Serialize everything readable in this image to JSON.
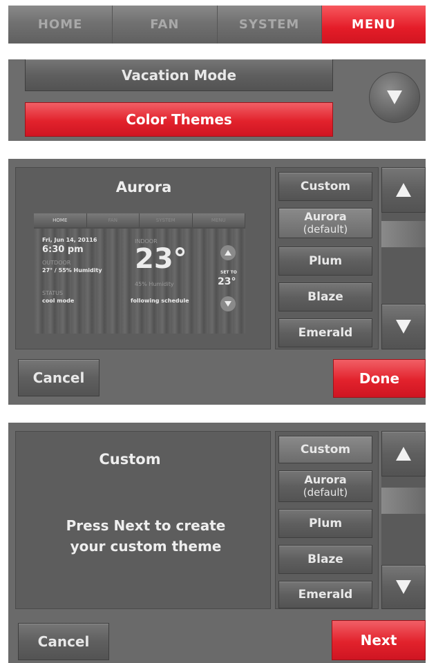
{
  "tabs": [
    "HOME",
    "FAN",
    "SYSTEM",
    "MENU"
  ],
  "menu_list": {
    "vacation_mode": "Vacation Mode",
    "color_themes": "Color Themes"
  },
  "theme_screen_1": {
    "title": "Aurora",
    "preview": {
      "tabs": [
        "HOME",
        "FAN",
        "SYSTEM",
        "MENU"
      ],
      "date": "Fri, Jun 14, 20116",
      "time": "6:30 pm",
      "outdoor_label": "OUTDOOR",
      "outdoor_value": "27° / 55% Humidity",
      "status_label": "STATUS",
      "status_value": "cool mode",
      "indoor_label": "INDOOR",
      "indoor_temp": "23°",
      "indoor_humidity": "45% Humidity",
      "schedule": "following schedule",
      "set_to_label": "SET TO",
      "set_to_value": "23°"
    },
    "options": [
      "Custom",
      "Aurora",
      "(default)",
      "Plum",
      "Blaze",
      "Emerald"
    ],
    "cancel": "Cancel",
    "done": "Done"
  },
  "theme_screen_2": {
    "title": "Custom",
    "message_line1": "Press Next to create",
    "message_line2": "your custom theme",
    "options": [
      "Custom",
      "Aurora",
      "(default)",
      "Plum",
      "Blaze",
      "Emerald"
    ],
    "cancel": "Cancel",
    "next": "Next"
  },
  "icons": {
    "scroll_up": "up-triangle-icon",
    "scroll_down": "down-triangle-icon"
  },
  "colors": {
    "accent_red": "#e2222c",
    "panel_gray": "#6a6a6a"
  }
}
